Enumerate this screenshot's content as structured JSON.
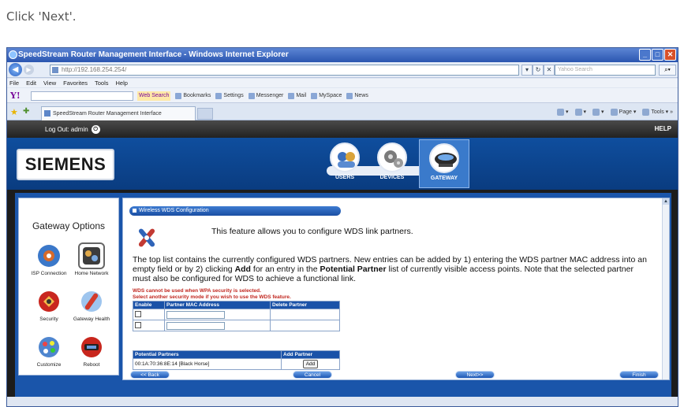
{
  "instruction": "Click 'Next'.",
  "window": {
    "title": "SpeedStream Router Management Interface - Windows Internet Explorer",
    "address": "http://192.168.254.254/",
    "search_placeholder": "Yahoo Search",
    "menu": [
      "File",
      "Edit",
      "View",
      "Favorites",
      "Tools",
      "Help"
    ],
    "yahoo_logo": "Y!",
    "yahoo_toolbar": [
      "Web Search",
      "Bookmarks",
      "Settings",
      "Messenger",
      "Mail",
      "MySpace",
      "News"
    ],
    "tab_title": "SpeedStream Router Management Interface",
    "commands": [
      "Page",
      "Tools"
    ]
  },
  "router": {
    "logout_label": "Log Out: admin",
    "help_label": "HELP",
    "brand": "SIEMENS",
    "nav": [
      "USERS",
      "DEVICES",
      "GATEWAY"
    ],
    "sidebar_title": "Gateway Options",
    "options": [
      {
        "label": "ISP Connection"
      },
      {
        "label": "Home Network"
      },
      {
        "label": "Security"
      },
      {
        "label": "Gateway Health"
      },
      {
        "label": "Customize"
      },
      {
        "label": "Reboot"
      }
    ],
    "section_title": "Wireless WDS Configuration",
    "intro": "This feature allows you to configure WDS link partners.",
    "desc_1": "The top list contains the currently configured WDS partners. New entries can be added by 1) entering the WDS partner MAC address into an empty field or by 2) clicking ",
    "desc_add": "Add",
    "desc_2": " for an entry in the ",
    "desc_pp": "Potential Partner",
    "desc_3": " list of currently visible access points. Note that the selected partner must also be configured for WDS to achieve a functional link.",
    "warn_1": "WDS cannot be used when WPA security is selected.",
    "warn_2": "Select another security mode if you wish to use the WDS feature.",
    "wds_headers": [
      "Enable",
      "Partner MAC Address",
      "Delete Partner"
    ],
    "pp_headers": [
      "Potential Partners",
      "Add Partner"
    ],
    "pp_rows": [
      {
        "partner": "00:1A:70:36:8E:14 [Black Horse]",
        "action": "Add"
      }
    ],
    "buttons": {
      "back": "<< Back",
      "cancel": "Cancel",
      "next": "Next>>",
      "finish": "Finish"
    }
  }
}
